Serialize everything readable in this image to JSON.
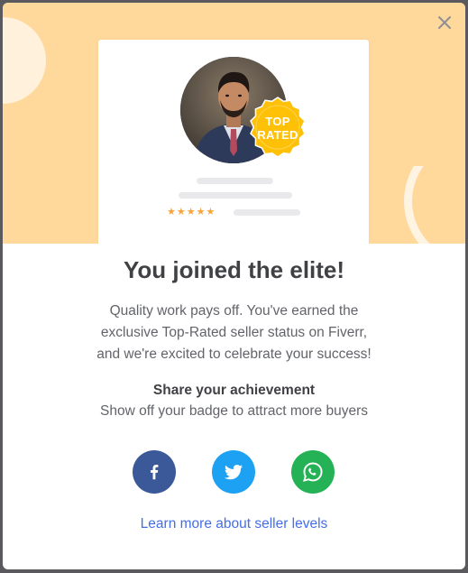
{
  "badge": {
    "line1": "TOP",
    "line2": "RATED"
  },
  "rating": {
    "stars": "★★★★★"
  },
  "title": "You joined the elite!",
  "description": {
    "line1": "Quality work pays off. You've earned the",
    "line2": "exclusive Top-Rated seller status on Fiverr,",
    "line3": "and we're excited to celebrate your success!"
  },
  "share": {
    "title": "Share your achievement",
    "subtitle": "Show off your badge to attract more buyers"
  },
  "social": [
    {
      "icon": "facebook-icon",
      "color": "#3b5998"
    },
    {
      "icon": "twitter-icon",
      "color": "#1da1f2"
    },
    {
      "icon": "whatsapp-icon",
      "color": "#25b155"
    }
  ],
  "link": {
    "label": "Learn more about seller levels",
    "color": "#446ee7"
  },
  "colors": {
    "hero_bg": "#ffd89c",
    "badge": "#ffc107",
    "star": "#f6a43c",
    "title": "#404145"
  }
}
